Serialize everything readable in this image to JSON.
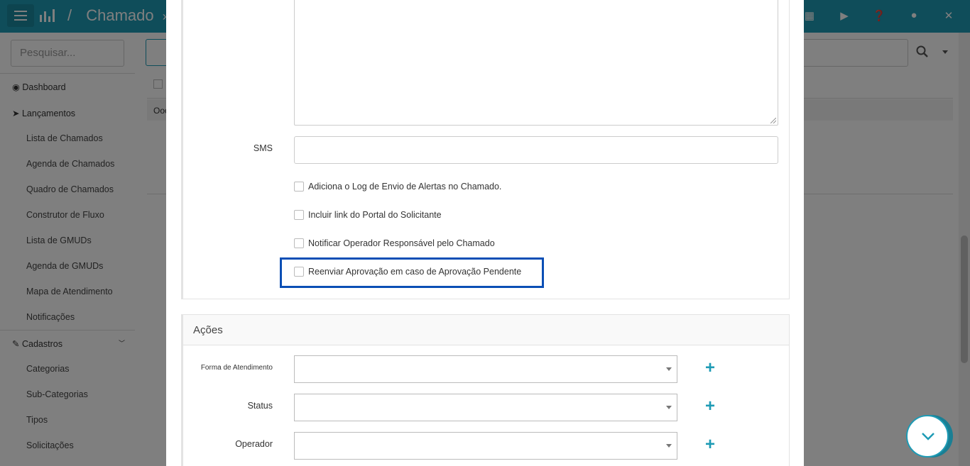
{
  "header": {
    "breadcrumb_separator": "/",
    "title": "Chamado",
    "title_suffix": "»"
  },
  "sidebar": {
    "search_placeholder": "Pesquisar...",
    "items": [
      {
        "label": "Dashboard"
      },
      {
        "label": "Lançamentos"
      },
      {
        "label": "Lista de Chamados"
      },
      {
        "label": "Agenda de Chamados"
      },
      {
        "label": "Quadro de Chamados"
      },
      {
        "label": "Construtor de Fluxo"
      },
      {
        "label": "Lista de GMUDs"
      },
      {
        "label": "Agenda de GMUDs"
      },
      {
        "label": "Mapa de Atendimento"
      },
      {
        "label": "Notificações"
      },
      {
        "label": "Cadastros"
      },
      {
        "label": "Categorias"
      },
      {
        "label": "Sub-Categorias"
      },
      {
        "label": "Tipos"
      },
      {
        "label": "Solicitações"
      }
    ]
  },
  "background": {
    "table_cell": "Ooo"
  },
  "modal": {
    "sms_label": "SMS",
    "checkboxes": [
      {
        "label": "Adiciona o Log de Envio de Alertas no Chamado."
      },
      {
        "label": "Incluir link do Portal do Solicitante"
      },
      {
        "label": "Notificar Operador Responsável pelo Chamado"
      },
      {
        "label": "Reenviar Aprovação em caso de Aprovação Pendente"
      }
    ],
    "acoes": {
      "title": "Ações",
      "forma_label": "Forma de Atendimento",
      "status_label": "Status",
      "operador_label": "Operador",
      "add_symbol": "+"
    }
  },
  "colors": {
    "brand": "#1e9bb5",
    "highlight": "#0b4fb5"
  }
}
